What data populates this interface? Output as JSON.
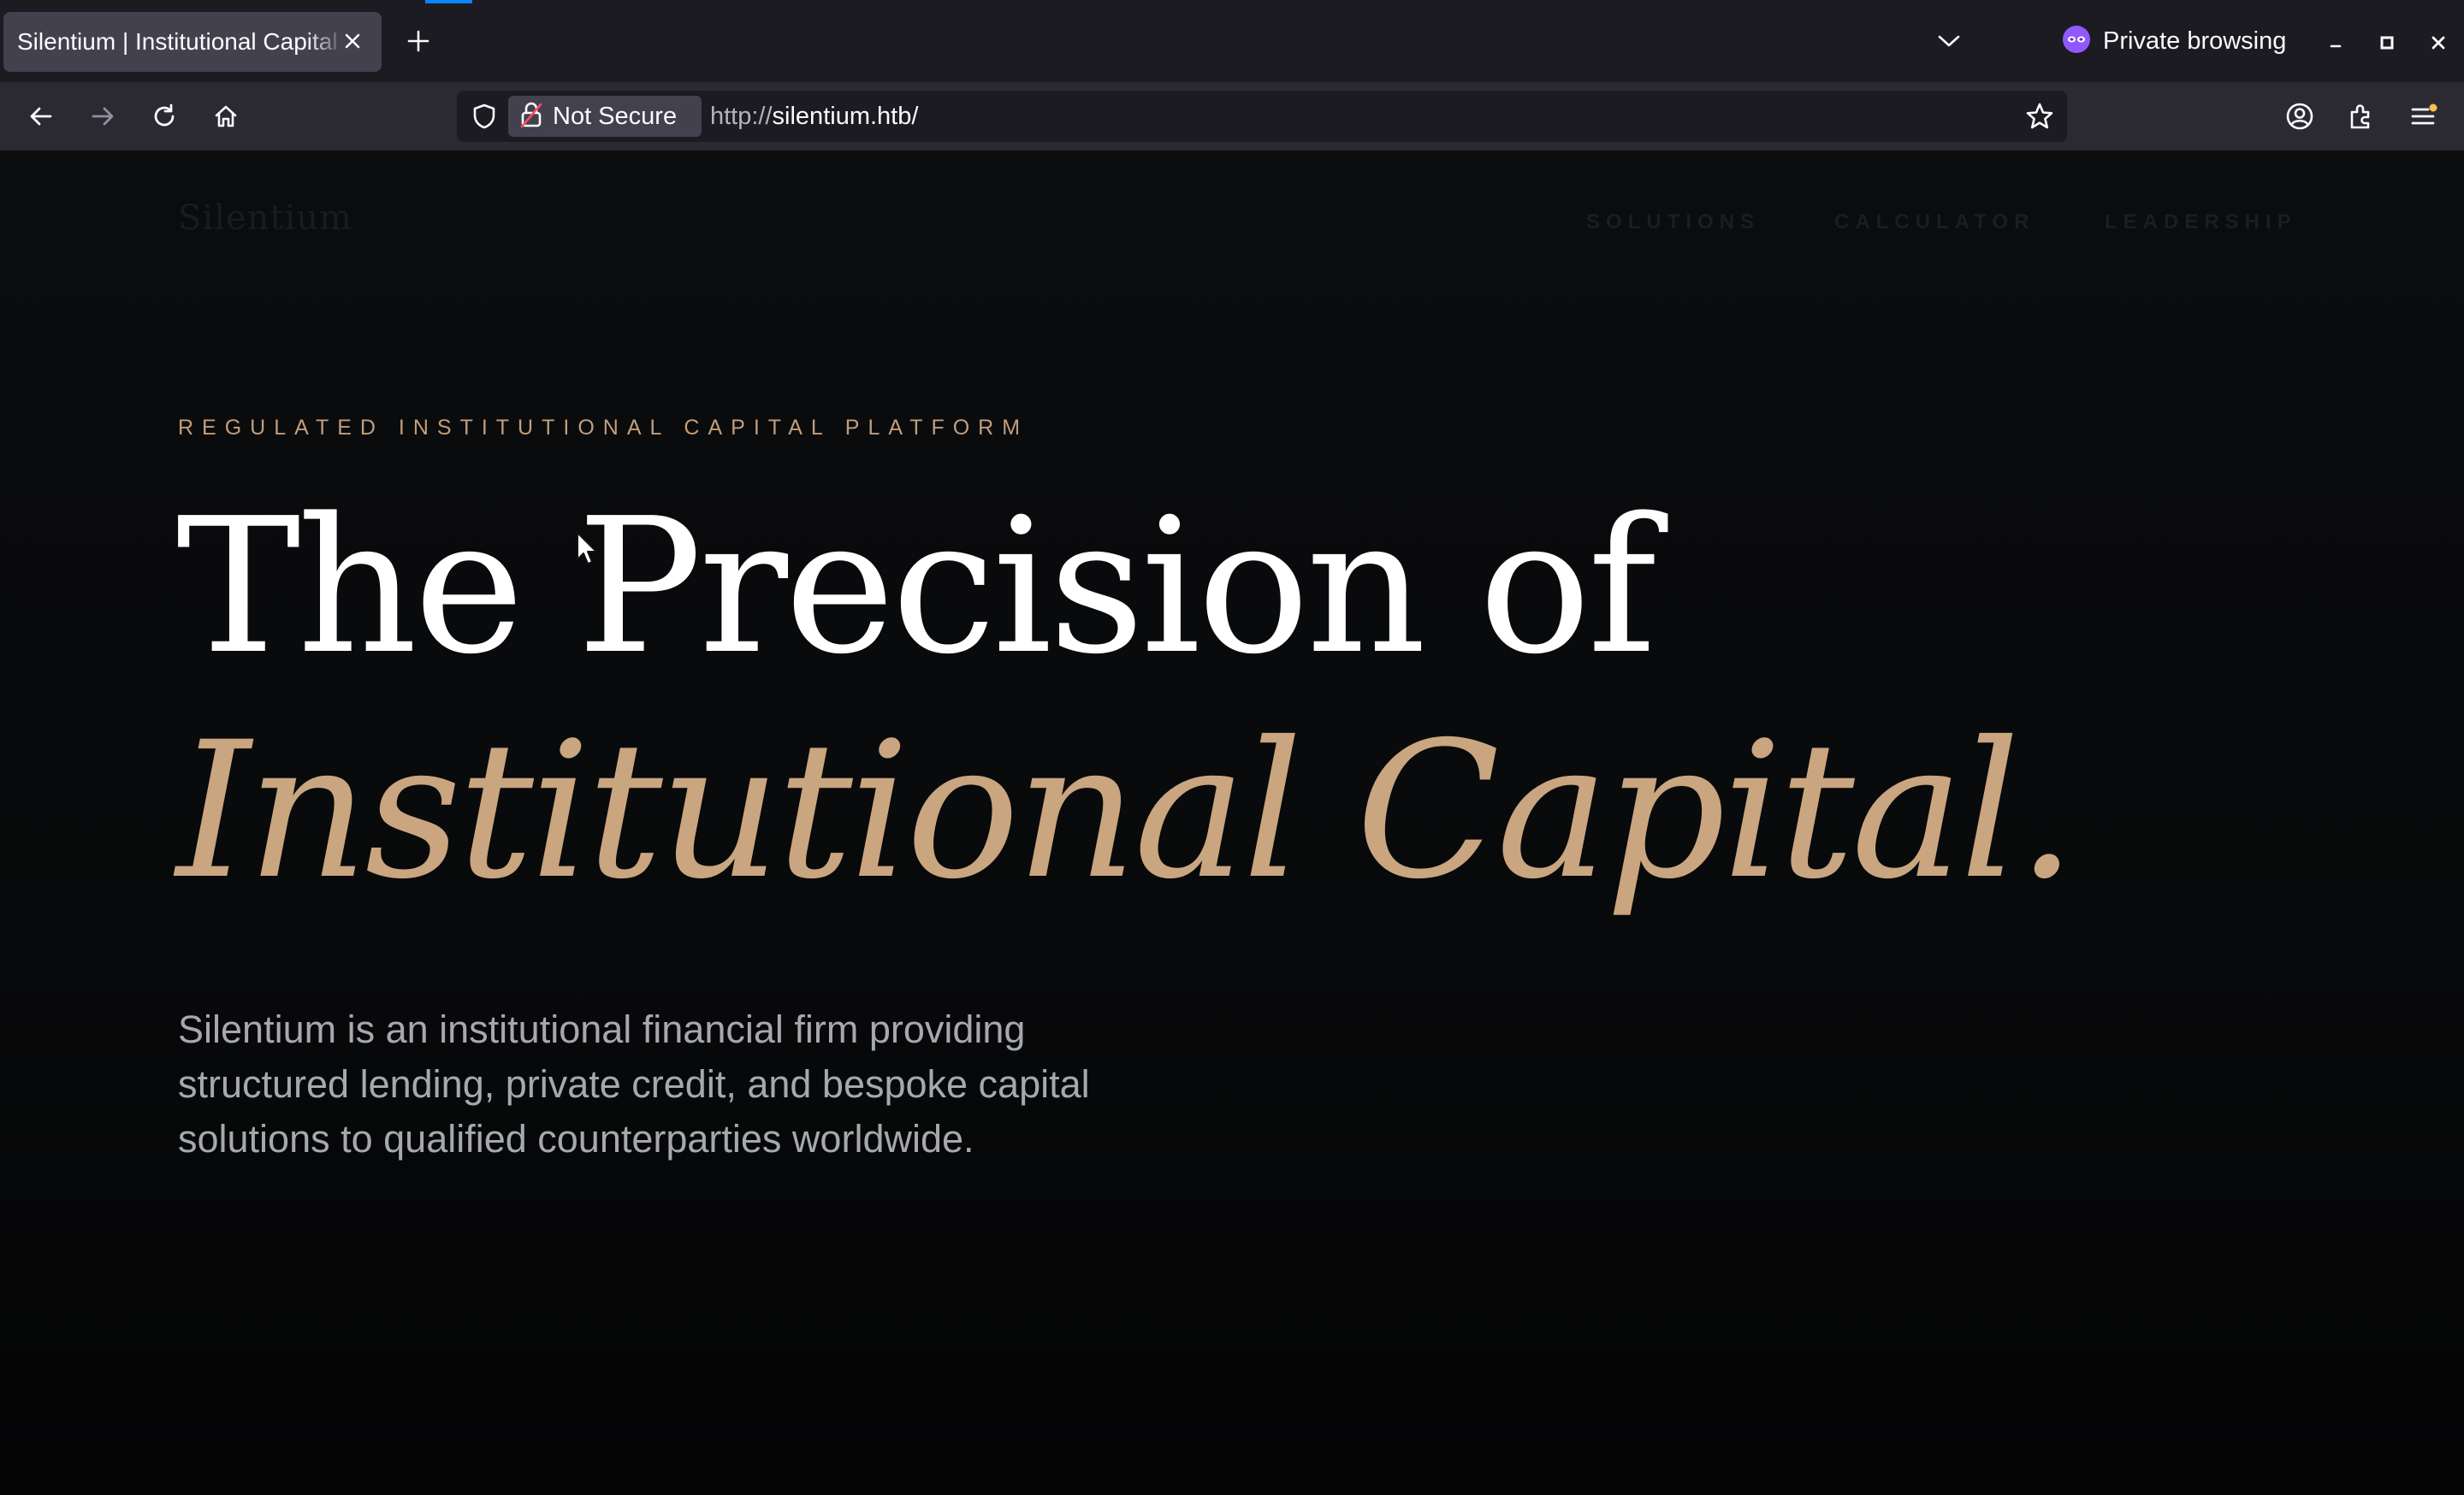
{
  "browser": {
    "tab": {
      "title": "Silentium | Institutional Capital"
    },
    "private_label": "Private browsing",
    "address_bar": {
      "security_label": "Not Secure",
      "url_prefix": "http://",
      "url_host": "silentium.htb/"
    },
    "icons": {
      "back": "back-arrow-icon",
      "forward": "forward-arrow-icon",
      "reload": "reload-icon",
      "home": "home-icon",
      "bookmark": "star-icon",
      "account": "account-icon",
      "extensions": "extensions-icon",
      "menu": "hamburger-menu-icon"
    },
    "colors": {
      "chrome_dark": "#1c1b22",
      "toolbar": "#2b2a33",
      "active_tab": "#42414d",
      "accent_blue": "#0a84ff",
      "private_purple": "#9059ff"
    }
  },
  "site": {
    "logo": "Silentium",
    "nav": [
      "SOLUTIONS",
      "CALCULATOR",
      "LEADERSHIP"
    ],
    "eyebrow": "REGULATED INSTITUTIONAL CAPITAL PLATFORM",
    "headline_line1": "The Precision of",
    "headline_line2": "Institutional Capital.",
    "intro_lines": [
      "Silentium is an institutional financial firm providing",
      "structured lending, private credit, and bespoke capital",
      "solutions to qualified counterparties worldwide."
    ],
    "colors": {
      "background": "#08090a",
      "gold_accent": "#c9a580",
      "headline": "#ffffff",
      "body_text": "#a6a8ae"
    }
  }
}
